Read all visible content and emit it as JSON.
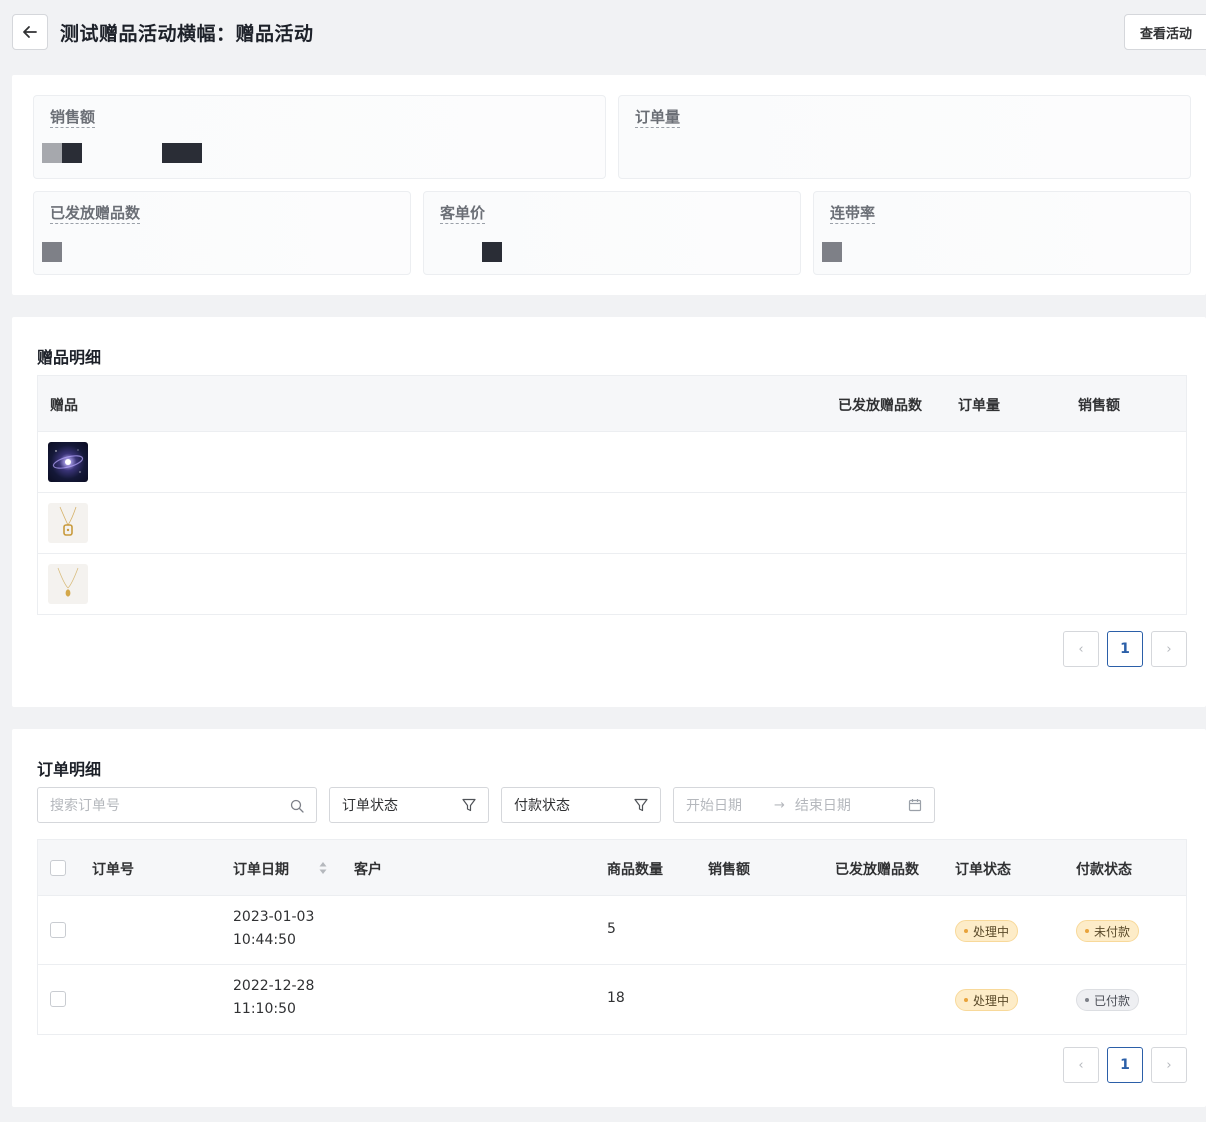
{
  "header": {
    "title": "测试赠品活动横幅：赠品活动",
    "view_button": "查看活动"
  },
  "stats": {
    "sales": "销售额",
    "orders": "订单量",
    "gifts_issued": "已发放赠品数",
    "avg_price": "客单价",
    "attach_rate": "连带率"
  },
  "gift_section": {
    "title": "赠品明细",
    "columns": [
      "赠品",
      "已发放赠品数",
      "订单量",
      "销售额"
    ],
    "rows": [
      {
        "image": "galaxy-image"
      },
      {
        "image": "necklace-lock-image"
      },
      {
        "image": "necklace-pendant-image"
      }
    ],
    "pagination": {
      "page": "1"
    }
  },
  "order_section": {
    "title": "订单明细",
    "search_placeholder": "搜索订单号",
    "order_status_filter": "订单状态",
    "payment_status_filter": "付款状态",
    "start_date_placeholder": "开始日期",
    "end_date_placeholder": "结束日期",
    "columns": [
      "订单号",
      "订单日期",
      "客户",
      "商品数量",
      "销售额",
      "已发放赠品数",
      "订单状态",
      "付款状态"
    ],
    "rows": [
      {
        "date": "2023-01-03",
        "time": "10:44:50",
        "quantity": "5",
        "order_status": "处理中",
        "payment_status": "未付款"
      },
      {
        "date": "2022-12-28",
        "time": "11:10:50",
        "quantity": "18",
        "order_status": "处理中",
        "payment_status": "已付款"
      }
    ],
    "pagination": {
      "page": "1"
    }
  },
  "colors": {
    "accent": "#2b5fa8",
    "processing_badge": "#fdecc8",
    "paid_badge": "#eeeff2"
  }
}
